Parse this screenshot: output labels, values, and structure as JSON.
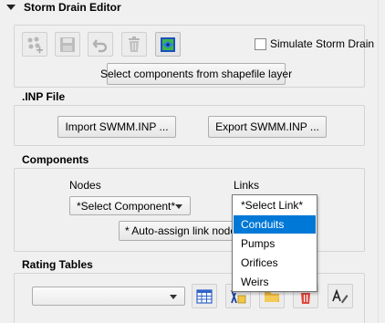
{
  "panel": {
    "title": "Storm Drain Editor",
    "simulate_label": "Simulate Storm Drain",
    "select_components_label": "Select components from shapefile layer"
  },
  "toolbar": {
    "icons": [
      "add-points-icon",
      "save-icon",
      "undo-icon",
      "delete-icon",
      "schematize-icon"
    ]
  },
  "inp_file": {
    "title": ".INP File",
    "import_label": "Import SWMM.INP ...",
    "export_label": "Export SWMM.INP ..."
  },
  "components": {
    "title": "Components",
    "nodes_label": "Nodes",
    "links_label": "Links",
    "nodes_combo_value": "*Select Component*",
    "auto_assign_label": "* Auto-assign link nodes *",
    "links_dropdown": {
      "selected_value": "*Select Link*",
      "options": [
        "Conduits",
        "Pumps",
        "Orifices",
        "Weirs"
      ],
      "highlighted_option": "Conduits"
    }
  },
  "rating_tables": {
    "title": "Rating Tables",
    "combo_value": "",
    "icons": [
      "table-icon",
      "import-rating-icon",
      "folder-icon",
      "delete-icon",
      "rename-icon"
    ]
  },
  "colors": {
    "highlight": "#0078d7",
    "panel_bg": "#f0f0f0",
    "group_border": "#d4d4d4"
  }
}
